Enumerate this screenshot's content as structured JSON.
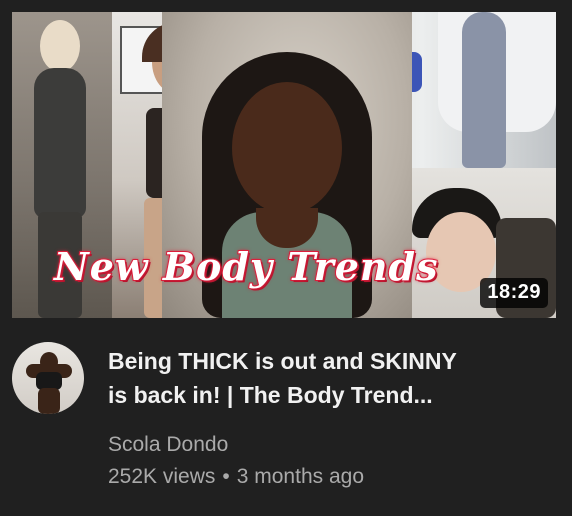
{
  "thumbnail": {
    "overlay_title": "New Body Trends",
    "duration": "18:29",
    "colors": {
      "title_stroke": "#d81f3a",
      "duration_bg": "#000000"
    }
  },
  "video": {
    "title_line1": "Being THICK is out and SKINNY",
    "title_line2": "is back in! | The Body Trend...",
    "channel": "Scola Dondo",
    "views": "252K views",
    "separator": "•",
    "age": "3 months ago"
  },
  "colors": {
    "card_background": "#202020",
    "primary_text": "#f1f1f1",
    "secondary_text": "#aaaaaa"
  }
}
